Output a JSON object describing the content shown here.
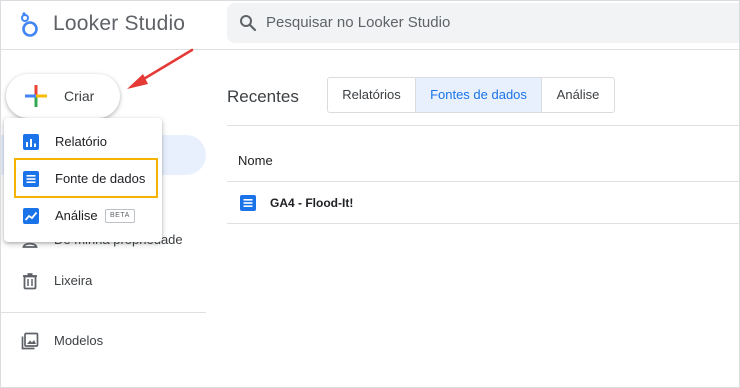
{
  "app": {
    "title": "Looker Studio",
    "logo_icon": "looker-studio-logo"
  },
  "search": {
    "placeholder": "Pesquisar no Looker Studio"
  },
  "create_button": {
    "label": "Criar"
  },
  "create_menu": {
    "items": [
      {
        "label": "Relatório",
        "icon": "report-icon"
      },
      {
        "label": "Fonte de dados",
        "icon": "data-source-icon",
        "highlighted": true
      },
      {
        "label": "Análise",
        "icon": "explorer-icon",
        "badge": "BETA"
      }
    ]
  },
  "sidebar": {
    "items": [
      {
        "label": "De minha propriedade",
        "icon": "owned-icon"
      },
      {
        "label": "Lixeira",
        "icon": "trash-icon"
      },
      {
        "label": "Modelos",
        "icon": "templates-icon"
      }
    ]
  },
  "main": {
    "heading": "Recentes",
    "tabs": [
      {
        "label": "Relatórios",
        "active": false
      },
      {
        "label": "Fontes de dados",
        "active": true
      },
      {
        "label": "Análise",
        "active": false
      }
    ],
    "table": {
      "column_header": "Nome",
      "rows": [
        {
          "name": "GA4 - Flood-It!",
          "icon": "data-source-icon"
        }
      ]
    }
  },
  "colors": {
    "accent": "#1a73e8",
    "highlight_border": "#f4b400",
    "arrow": "#e53935"
  }
}
